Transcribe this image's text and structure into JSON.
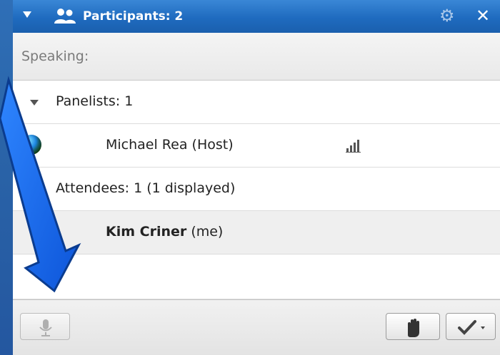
{
  "panel": {
    "title": "Participants: 2",
    "speaking_label": "Speaking:"
  },
  "groups": {
    "panelists_label": "Panelists: 1",
    "attendees_label": "Attendees: 1 (1 displayed)"
  },
  "participants": [
    {
      "name": "Michael Rea",
      "suffix": "(Host)"
    },
    {
      "name": "Kim Criner",
      "suffix": "(me)"
    }
  ],
  "icons": {
    "panel_collapse": "triangle-down-icon",
    "people": "people-icon",
    "settings": "gear-icon",
    "close": "close-icon",
    "status_globe": "globe-icon",
    "signal": "signal-bars-icon",
    "microphone": "microphone-icon",
    "raise_hand": "raise-hand-icon",
    "feedback": "checkmark-dropdown-icon",
    "arrow_annotation": "arrow-icon"
  },
  "colors": {
    "background_blue": "#2a64a8",
    "titlebar_blue": "#1f6bbf",
    "selected_row": "#efefef"
  }
}
